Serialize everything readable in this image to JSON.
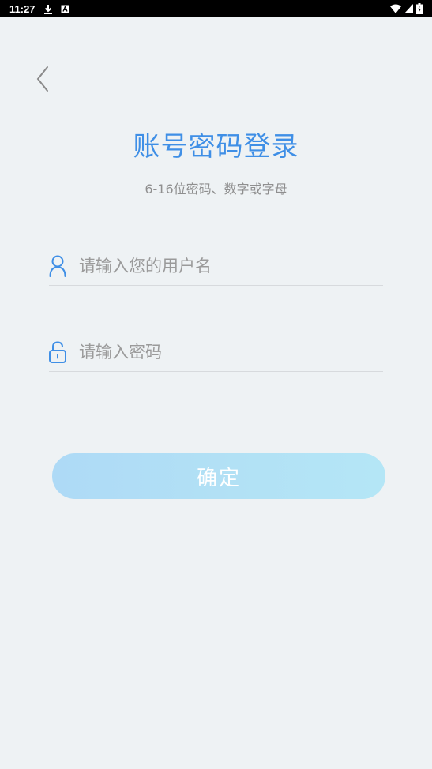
{
  "status_bar": {
    "time": "11:27",
    "icons": [
      "download-icon",
      "a-notification-icon",
      "wifi-icon",
      "signal-icon",
      "battery-charging-icon"
    ]
  },
  "nav": {
    "back_icon": "chevron-left-icon"
  },
  "header": {
    "title": "账号密码登录",
    "subtitle": "6-16位密码、数字或字母"
  },
  "form": {
    "username": {
      "placeholder": "请输入您的用户名",
      "value": "",
      "icon": "user-icon"
    },
    "password": {
      "placeholder": "请输入密码",
      "value": "",
      "icon": "unlock-icon"
    },
    "submit_label": "确定"
  },
  "colors": {
    "accent": "#3f8fe6",
    "background": "#eef2f4",
    "button": "#b2e1f5"
  }
}
